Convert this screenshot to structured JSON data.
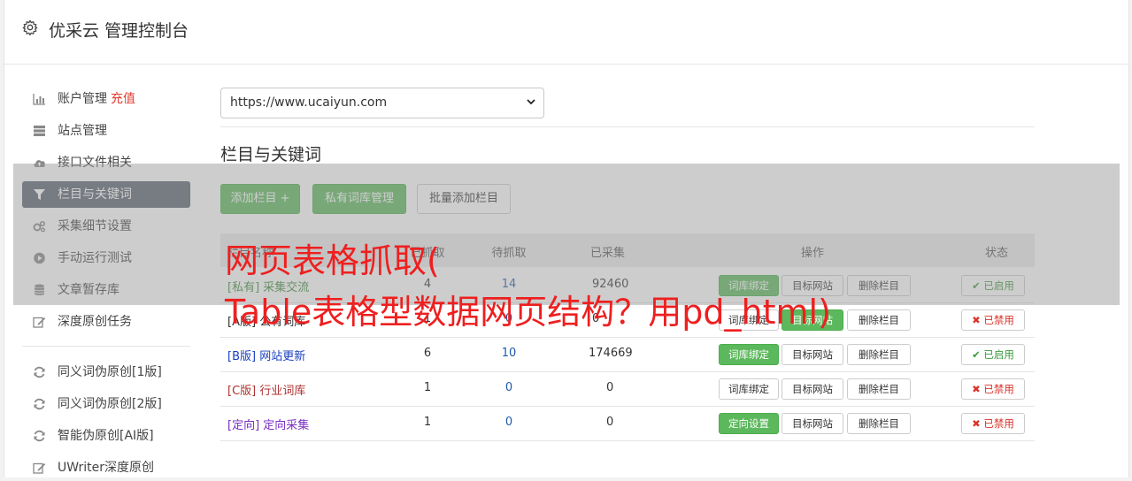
{
  "header": {
    "title": "优采云 管理控制台"
  },
  "sidebar": {
    "items": [
      {
        "label": "账户管理",
        "extra": "充值",
        "icon": "bar-chart-icon"
      },
      {
        "label": "站点管理",
        "icon": "server-icon"
      },
      {
        "label": "接口文件相关",
        "icon": "cloud-upload-icon"
      },
      {
        "label": "栏目与关键词",
        "icon": "filter-icon",
        "active": true
      },
      {
        "label": "采集细节设置",
        "icon": "gears-icon"
      },
      {
        "label": "手动运行测试",
        "icon": "play-circle-icon"
      },
      {
        "label": "文章暂存库",
        "icon": "database-icon"
      },
      {
        "label": "深度原创任务",
        "icon": "edit-icon"
      },
      {
        "label": "同义词伪原创[1版]",
        "icon": "refresh-icon"
      },
      {
        "label": "同义词伪原创[2版]",
        "icon": "refresh-icon"
      },
      {
        "label": "智能伪原创[AI版]",
        "icon": "refresh-icon"
      },
      {
        "label": "UWriter深度原创",
        "icon": "edit-icon"
      }
    ]
  },
  "site_select": {
    "value": "https://www.ucaiyun.com"
  },
  "section": {
    "title": "栏目与关键词"
  },
  "toolbar": {
    "add_label": "添加栏目 +",
    "private_label": "私有词库管理",
    "batch_label": "批量添加栏目"
  },
  "table": {
    "headers": {
      "name": "栏目名称",
      "c1": "已抓取",
      "c2": "待抓取",
      "c3": "已采集",
      "ops": "操作",
      "status": "状态"
    },
    "rows": [
      {
        "tag": "[私有]",
        "name": "采集交流",
        "c1": "4",
        "c2": "14",
        "c3": "92460",
        "op1": "词库绑定",
        "op2": "目标网站",
        "op3": "删除栏目",
        "status": "已启用",
        "color": "#3c8c3c"
      },
      {
        "tag": "[A版]",
        "name": "公有词库",
        "c1": "1",
        "c2": "0",
        "c3": "0",
        "op1": "词库绑定",
        "op2": "目标网站",
        "op3": "删除栏目",
        "status": "已禁用",
        "color": "#333333"
      },
      {
        "tag": "[B版]",
        "name": "网站更新",
        "c1": "6",
        "c2": "10",
        "c3": "174669",
        "op1": "词库绑定",
        "op2": "目标网站",
        "op3": "删除栏目",
        "status": "已启用",
        "color": "#1a3fbf"
      },
      {
        "tag": "[C版]",
        "name": "行业词库",
        "c1": "1",
        "c2": "0",
        "c3": "0",
        "op1": "词库绑定",
        "op2": "目标网站",
        "op3": "删除栏目",
        "status": "已禁用",
        "color": "#b03030"
      },
      {
        "tag": "[定向]",
        "name": "定向采集",
        "c1": "1",
        "c2": "0",
        "c3": "0",
        "op1": "定向设置",
        "op2": "目标网站",
        "op3": "删除栏目",
        "status": "已禁用",
        "color": "#7a2ec0"
      }
    ]
  },
  "overlay": {
    "line1": "网页表格抓取(",
    "line2": "Table表格型数据网页结构？用pd_html)"
  },
  "colors": {
    "accent_green": "#5cb85c",
    "active_nav": "#5a6370",
    "danger_red": "#d9332b",
    "banner_red": "#ee1f1f"
  }
}
